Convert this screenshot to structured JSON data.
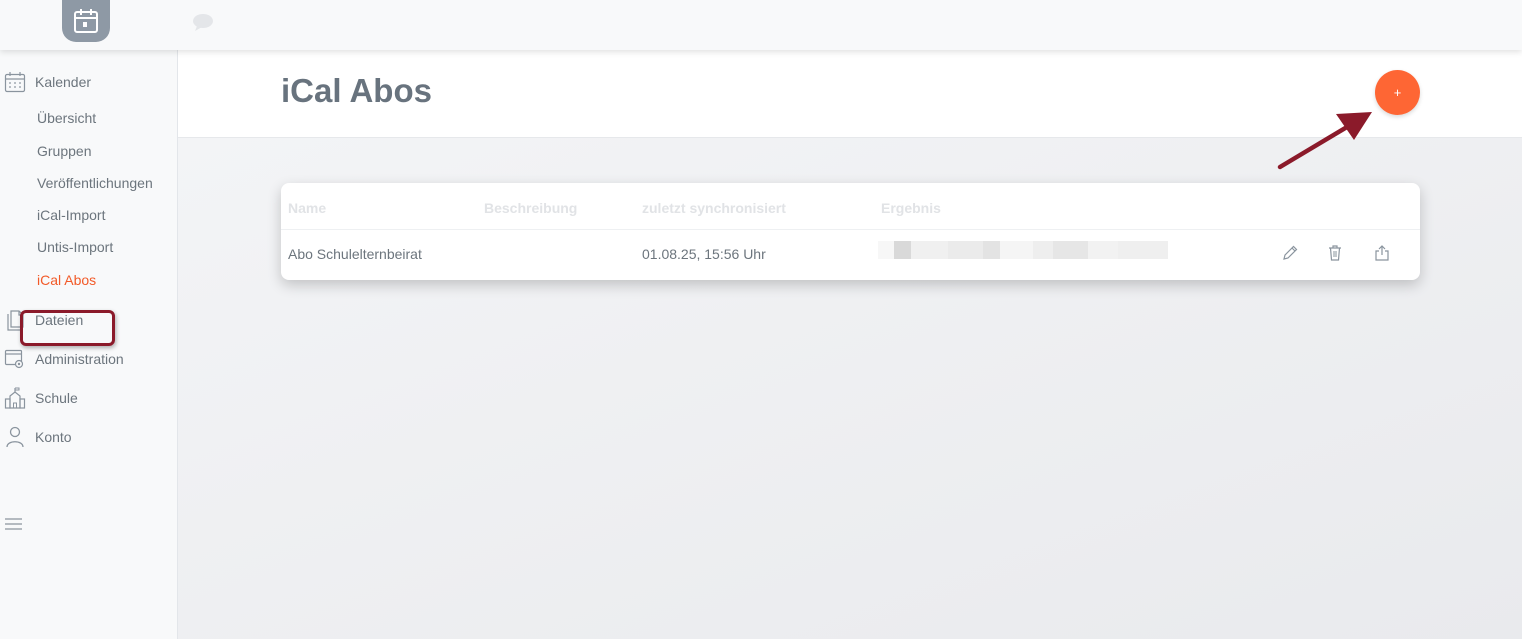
{
  "nav": {
    "kalender": "Kalender",
    "sub_items": [
      "Übersicht",
      "Gruppen",
      "Veröffentlichungen",
      "iCal-Import",
      "Untis-Import",
      "iCal Abos"
    ],
    "dateien": "Dateien",
    "administration": "Administration",
    "schule": "Schule",
    "konto": "Konto"
  },
  "header": {
    "title": "iCal Abos",
    "add_label": "+"
  },
  "table": {
    "columns": [
      "Name",
      "Beschreibung",
      "zuletzt synchronisiert",
      "Ergebnis"
    ],
    "rows": [
      {
        "name": "Abo Schulelternbeirat",
        "description": "",
        "last_sync": "01.08.25, 15:56 Uhr",
        "result": ""
      }
    ]
  },
  "icons": {
    "logo": "calendar-icon",
    "chat": "chat-bubble-icon",
    "edit": "pencil-icon",
    "delete": "trash-icon",
    "export": "export-icon"
  },
  "colors": {
    "accent": "#fe6634",
    "active_nav": "#f25a28",
    "annotation": "#8b1a2a"
  }
}
